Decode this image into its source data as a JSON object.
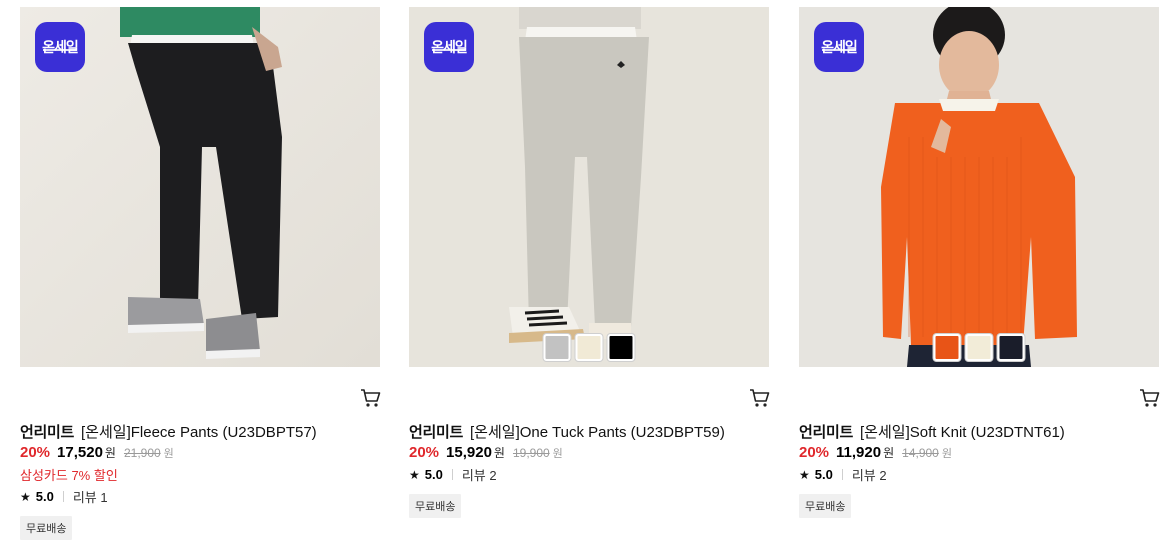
{
  "products": [
    {
      "badge": "온세일",
      "brand": "언리미트",
      "name": "[온세일]Fleece Pants (U23DBPT57)",
      "discount": "20%",
      "price": "17,520",
      "currency": "원",
      "original_price": "21,900",
      "original_currency": "원",
      "promo": "삼성카드 7% 할인",
      "star": "★",
      "rating": "5.0",
      "review": "리뷰 1",
      "tag": "무료배송",
      "cart_icon": "cart-icon",
      "image_colors": {
        "bg": "#eae7e1",
        "pants": "#1d1d1f",
        "top": "#2e8a62"
      },
      "swatches": []
    },
    {
      "badge": "온세일",
      "brand": "언리미트",
      "name": "[온세일]One Tuck Pants (U23DBPT59)",
      "discount": "20%",
      "price": "15,920",
      "currency": "원",
      "original_price": "19,900",
      "original_currency": "원",
      "star": "★",
      "rating": "5.0",
      "review": "리뷰 2",
      "tag": "무료배송",
      "cart_icon": "cart-icon",
      "image_colors": {
        "bg": "#e7e4dc",
        "pants": "#c9c7bf",
        "top": "#d9d6cf"
      },
      "swatches": [
        "#c2c2c2",
        "#f1ead6",
        "#000000"
      ]
    },
    {
      "badge": "온세일",
      "brand": "언리미트",
      "name": "[온세일]Soft Knit (U23DTNT61)",
      "discount": "20%",
      "price": "11,920",
      "currency": "원",
      "original_price": "14,900",
      "original_currency": "원",
      "star": "★",
      "rating": "5.0",
      "review": "리뷰 2",
      "tag": "무료배송",
      "cart_icon": "cart-icon",
      "image_colors": {
        "bg": "#e6e4df",
        "knit": "#f0601e",
        "pants": "#1e2434"
      },
      "swatches": [
        "#e85417",
        "#f2ecd8",
        "#1a1d2a"
      ]
    }
  ],
  "colors": {
    "sale_red": "#e0282c",
    "badge_blue": "#3a2fd6"
  }
}
